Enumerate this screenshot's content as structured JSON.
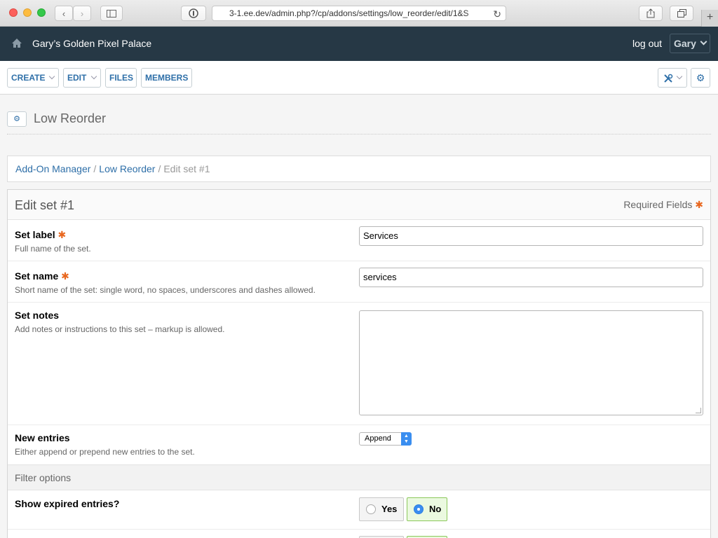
{
  "browser": {
    "url": "3-1.ee.dev/admin.php?/cp/addons/settings/low_reorder/edit/1&S"
  },
  "header": {
    "site_name": "Gary’s Golden Pixel Palace",
    "logout_label": "log out",
    "user_label": "Gary"
  },
  "toolbar": {
    "create_label": "CREATE",
    "edit_label": "EDIT",
    "files_label": "FILES",
    "members_label": "MEMBERS"
  },
  "page": {
    "title": "Low Reorder"
  },
  "breadcrumb": {
    "items": [
      "Add-On Manager",
      "Low Reorder"
    ],
    "current": "Edit set #1"
  },
  "form": {
    "title": "Edit set #1",
    "required_label": "Required Fields",
    "fields": [
      {
        "label": "Set label",
        "desc": "Full name of the set.",
        "value": "Services"
      },
      {
        "label": "Set name",
        "desc": "Short name of the set: single word, no spaces, underscores and dashes allowed.",
        "value": "services"
      },
      {
        "label": "Set notes",
        "desc": "Add notes or instructions to this set – markup is allowed.",
        "value": ""
      },
      {
        "label": "New entries",
        "desc": "Either append or prepend new entries to the set.",
        "value": "Append"
      }
    ],
    "section_title": "Filter options",
    "show_expired": {
      "label": "Show expired entries?",
      "yes_label": "Yes",
      "no_label": "No",
      "selected": "No"
    }
  },
  "colors": {
    "header_bg": "#263845",
    "link": "#2e6fa8",
    "required_star": "#e8671f",
    "selected_radio_bg": "#ebf9e0"
  }
}
